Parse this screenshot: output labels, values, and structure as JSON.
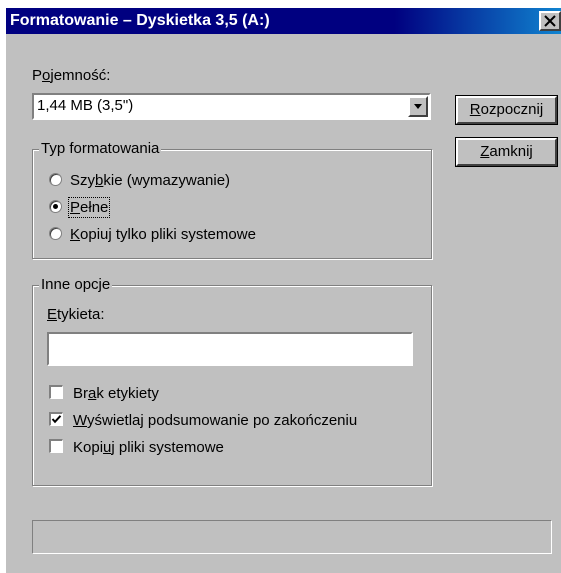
{
  "window": {
    "title": "Formatowanie – Dyskietka 3,5 (A:)"
  },
  "capacity": {
    "label_pre": "P",
    "label_ul": "o",
    "label_post": "jemność:",
    "selected": "1,44 MB (3,5\")"
  },
  "buttons": {
    "start": {
      "ul": "R",
      "rest": "ozpocznij"
    },
    "close": {
      "ul": "Z",
      "rest": "amknij"
    }
  },
  "format_type": {
    "legend": "Typ formatowania",
    "options": [
      {
        "pre": "Szy",
        "ul": "b",
        "post": "kie (wymazywanie)",
        "selected": false
      },
      {
        "pre": "",
        "ul": "P",
        "post": "ełne",
        "selected": true
      },
      {
        "pre": "",
        "ul": "K",
        "post": "opiuj tylko pliki systemowe",
        "selected": false
      }
    ]
  },
  "other_options": {
    "legend": "Inne opcje",
    "label": {
      "ul": "E",
      "rest": "tykieta:"
    },
    "label_value": "",
    "checks": [
      {
        "pre": "Br",
        "ul": "a",
        "post": "k etykiety",
        "checked": false
      },
      {
        "pre": "",
        "ul": "W",
        "post": "yświetlaj podsumowanie po zakończeniu",
        "checked": true
      },
      {
        "pre": "Kopi",
        "ul": "u",
        "post": "j pliki systemowe",
        "checked": false
      }
    ]
  },
  "icons": {
    "close": "close-icon",
    "dropdown": "chevron-down-icon",
    "check": "checkmark-icon"
  }
}
